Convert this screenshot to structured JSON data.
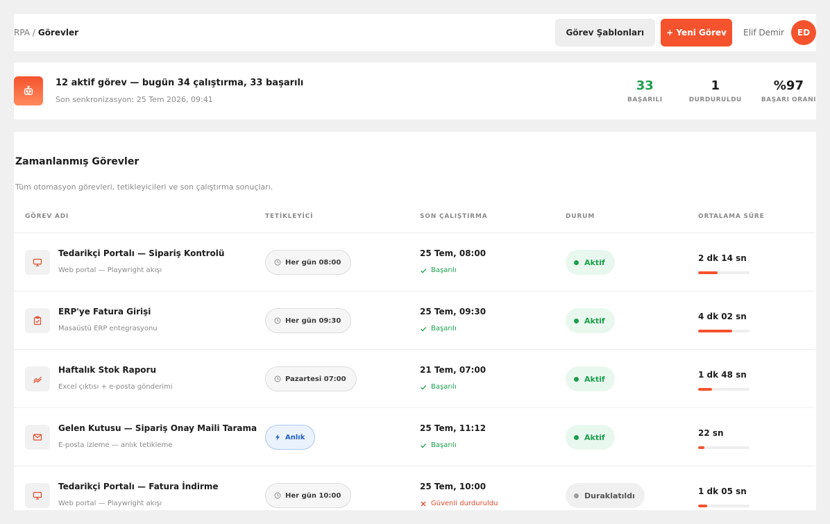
{
  "header": {
    "breadcrumb_root": "RPA /",
    "breadcrumb_current": "Görevler",
    "templates_button": "Görev Şablonları",
    "new_task_button": "+ Yeni Görev",
    "user_name": "Elif Demir",
    "avatar_initials": "ED"
  },
  "summary": {
    "title": "12 aktif görev — bugün 34 çalıştırma, 33 başarılı",
    "sync": "Son senkronizasyon: 25 Tem 2026, 09:41",
    "stats": [
      {
        "value": "33",
        "label": "BAŞARILI"
      },
      {
        "value": "1",
        "label": "DURDURULDU"
      },
      {
        "value": "%97",
        "label": "BAŞARI ORANI"
      }
    ]
  },
  "section": {
    "title": "Zamanlanmış Görevler",
    "description": "Tüm otomasyon görevleri, tetikleyicileri ve son çalıştırma sonuçları."
  },
  "table": {
    "headers": [
      "GÖREV ADI",
      "TETİKLEYİCİ",
      "SON ÇALIŞTIRMA",
      "DURUM",
      "ORTALAMA SÜRE"
    ],
    "rows": [
      {
        "name": "Tedarikçi Portalı — Sipariş Kontrolü",
        "desc": "Web portal — Playwright akışı",
        "icon": "monitor-icon",
        "trigger": "Her gün 08:00",
        "trigger_type": "schedule",
        "last_run": "25 Tem, 08:00",
        "run_status": "Başarılı",
        "run_ok": true,
        "status": "Aktif",
        "active": true,
        "avg": "2 dk 14 sn",
        "avg_fraction": 0.38
      },
      {
        "name": "ERP'ye Fatura Girişi",
        "desc": "Masaüstü ERP entegrasyonu",
        "icon": "clipboard-check-icon",
        "trigger": "Her gün 09:30",
        "trigger_type": "schedule",
        "last_run": "25 Tem, 09:30",
        "run_status": "Başarılı",
        "run_ok": true,
        "status": "Aktif",
        "active": true,
        "avg": "4 dk 02 sn",
        "avg_fraction": 0.66
      },
      {
        "name": "Haftalık Stok Raporu",
        "desc": "Excel çıktısı + e-posta gönderimi",
        "icon": "trend-chart-icon",
        "trigger": "Pazartesi 07:00",
        "trigger_type": "schedule",
        "last_run": "21 Tem, 07:00",
        "run_status": "Başarılı",
        "run_ok": true,
        "status": "Aktif",
        "active": true,
        "avg": "1 dk 48 sn",
        "avg_fraction": 0.27
      },
      {
        "name": "Gelen Kutusu — Sipariş Onay Maili Tarama",
        "desc": "E-posta izleme — anlık tetikleme",
        "icon": "mail-icon",
        "trigger": "Anlık",
        "trigger_type": "instant",
        "last_run": "25 Tem, 11:12",
        "run_status": "Başarılı",
        "run_ok": true,
        "status": "Aktif",
        "active": true,
        "avg": "22 sn",
        "avg_fraction": 0.12
      },
      {
        "name": "Tedarikçi Portalı — Fatura İndirme",
        "desc": "Web portal — Playwright akışı",
        "icon": "monitor-icon",
        "trigger": "Her gün 10:00",
        "trigger_type": "schedule",
        "last_run": "25 Tem, 10:00",
        "run_status": "Güvenli durduruldu",
        "run_ok": false,
        "status": "Duraklatıldı",
        "active": false,
        "avg": "1 dk 05 sn",
        "avg_fraction": 0.17
      }
    ]
  },
  "colors": {
    "accent": "#f4532e",
    "success": "#1a9e4b",
    "info": "#1f5fbf",
    "muted": "#8a8a8a"
  }
}
